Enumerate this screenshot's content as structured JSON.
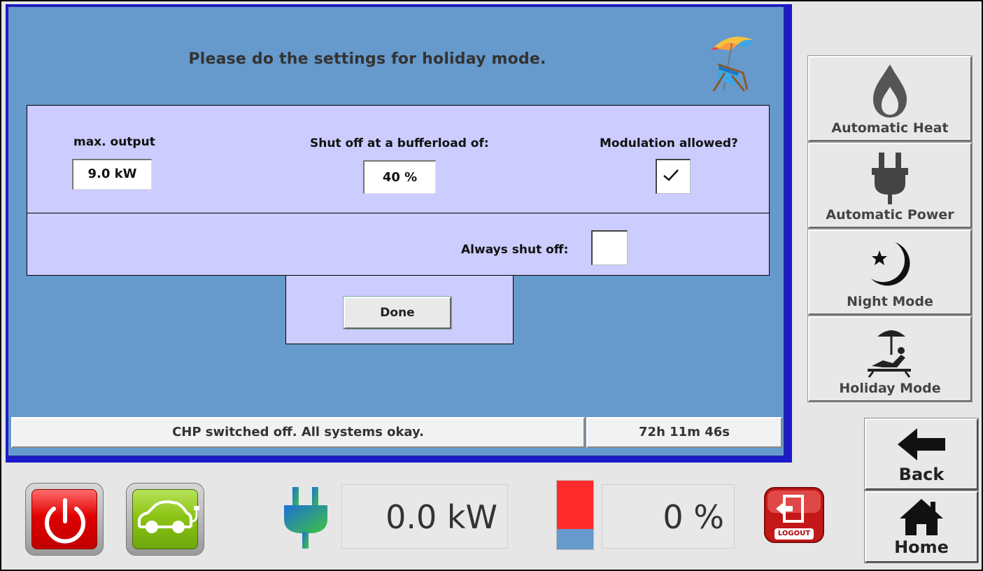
{
  "prompt": {
    "title": "Please do the settings for holiday mode."
  },
  "settings": {
    "max_output": {
      "label": "max. output",
      "value": "9.0 kW"
    },
    "shutoff_bufferload": {
      "label": "Shut off at a bufferload of:",
      "value": "40 %"
    },
    "modulation": {
      "label": "Modulation allowed?",
      "checked": true
    },
    "always_shut_off": {
      "label": "Always shut off:",
      "checked": false
    },
    "done_label": "Done"
  },
  "status": {
    "message": "CHP switched off. All systems okay.",
    "timer": "72h 11m 46s"
  },
  "modes": [
    {
      "label": "Automatic Heat",
      "icon": "flame-icon"
    },
    {
      "label": "Automatic Power",
      "icon": "plug-icon"
    },
    {
      "label": "Night Mode",
      "icon": "moon-star-icon"
    },
    {
      "label": "Holiday Mode",
      "icon": "beach-lounger-icon"
    }
  ],
  "nav": {
    "back_label": "Back",
    "home_label": "Home"
  },
  "toolbar": {
    "power_readout": "0.0 kW",
    "buffer_readout": "0 %",
    "buffer_gauge_red_fraction": 0.7,
    "logout_label": "LOGOUT"
  },
  "colors": {
    "panel_blue": "#6699cc",
    "panel_lilac": "#ccccff",
    "power_red": "#e00000",
    "ev_green": "#8cc414"
  }
}
